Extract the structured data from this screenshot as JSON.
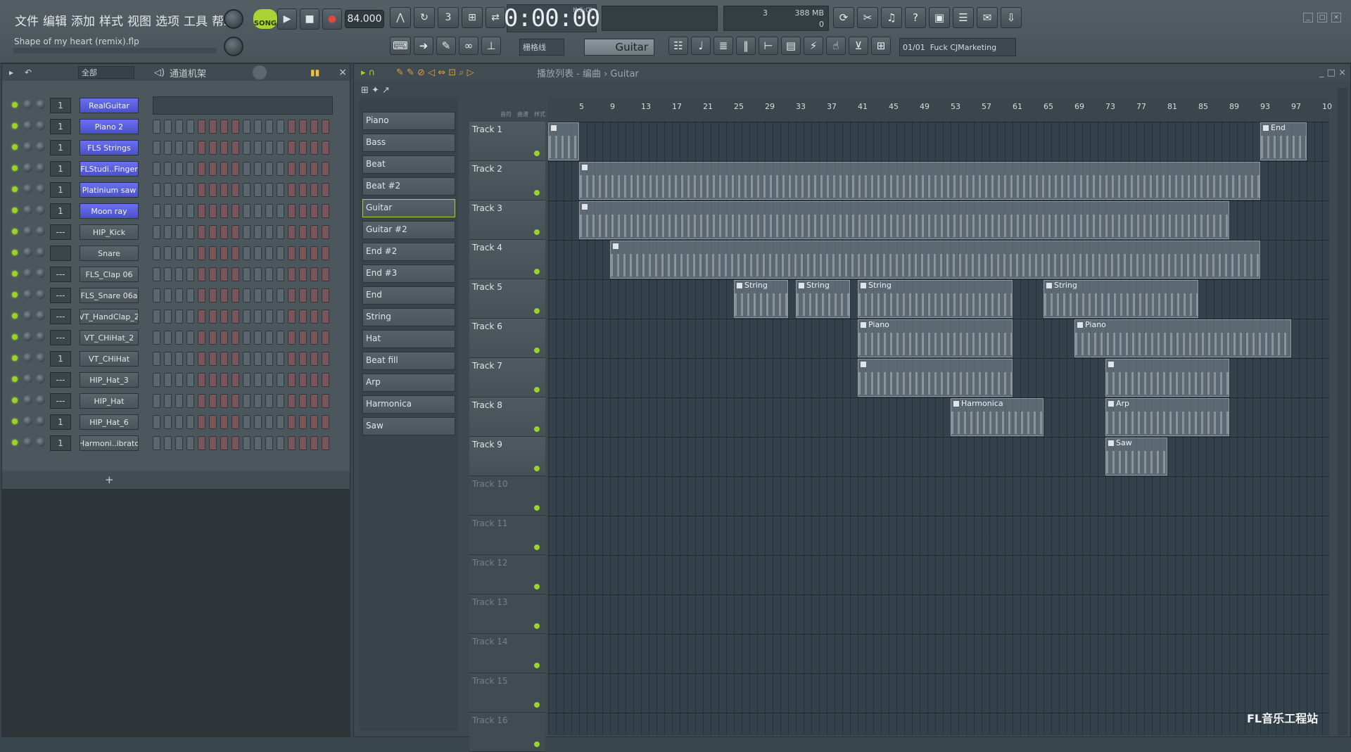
{
  "menu": [
    "文件",
    "编辑",
    "添加",
    "样式",
    "视图",
    "选项",
    "工具",
    "帮助"
  ],
  "project_file": "Shape of my heart (remix).flp",
  "transport": {
    "mode": "SONG",
    "tempo": "84.000",
    "time": "0:00:00",
    "time_unit": "M:S:CS"
  },
  "cpu": {
    "voices": "3",
    "memory": "388 MB",
    "zero": "0"
  },
  "snap": "栅格线",
  "selected_pattern": "Guitar",
  "hint": {
    "counter": "01/01",
    "text": "Fuck CJMarketing"
  },
  "rack": {
    "filter": "全部",
    "title": "通道机架",
    "add": "+",
    "channels": [
      {
        "name": "RealGuitar",
        "num": "1",
        "style": "blue"
      },
      {
        "name": "Piano 2",
        "num": "1",
        "style": "blue"
      },
      {
        "name": "FLS Strings",
        "num": "1",
        "style": "blue"
      },
      {
        "name": "FLStudi..Finger",
        "num": "1",
        "style": "blue"
      },
      {
        "name": "Platinium saw",
        "num": "1",
        "style": "blue"
      },
      {
        "name": "Moon ray",
        "num": "1",
        "style": "blue"
      },
      {
        "name": "HIP_Kick",
        "num": "---",
        "style": "gray"
      },
      {
        "name": "Snare",
        "num": "",
        "style": "gray"
      },
      {
        "name": "FLS_Clap 06",
        "num": "---",
        "style": "gray"
      },
      {
        "name": "FLS_Snare 06a",
        "num": "---",
        "style": "gray"
      },
      {
        "name": "VT_HandClap_2",
        "num": "---",
        "style": "gray"
      },
      {
        "name": "VT_CHiHat_2",
        "num": "---",
        "style": "gray"
      },
      {
        "name": "VT_CHiHat",
        "num": "1",
        "style": "gray"
      },
      {
        "name": "HIP_Hat_3",
        "num": "---",
        "style": "gray"
      },
      {
        "name": "HIP_Hat",
        "num": "---",
        "style": "gray"
      },
      {
        "name": "HIP_Hat_6",
        "num": "1",
        "style": "gray"
      },
      {
        "name": "Harmoni..ibrato",
        "num": "1",
        "style": "gray"
      }
    ]
  },
  "playlist": {
    "breadcrumb": "播放列表 - 编曲 › Guitar",
    "picker_tabs": [
      "音符",
      "曲谱",
      "样式"
    ],
    "patterns": [
      "Piano",
      "Bass",
      "Beat",
      "Beat #2",
      "Guitar",
      "Guitar #2",
      "End #2",
      "End #3",
      "End",
      "String",
      "Hat",
      "Beat fill",
      "Arp",
      "Harmonica",
      "Saw"
    ],
    "ruler": [
      "5",
      "9",
      "13",
      "17",
      "21",
      "25",
      "29",
      "33",
      "37",
      "41",
      "45",
      "49",
      "53",
      "57",
      "61",
      "65",
      "69",
      "73",
      "77",
      "81",
      "85",
      "89",
      "93",
      "97",
      "10"
    ],
    "tracks": [
      "Track 1",
      "Track 2",
      "Track 3",
      "Track 4",
      "Track 5",
      "Track 6",
      "Track 7",
      "Track 8",
      "Track 9",
      "Track 10",
      "Track 11",
      "Track 12",
      "Track 13",
      "Track 14",
      "Track 15",
      "Track 16"
    ],
    "clips": [
      {
        "label": "",
        "track": 0,
        "start": 1,
        "bars": 4
      },
      {
        "label": "End",
        "track": 0,
        "start": 93,
        "bars": 6
      },
      {
        "label": "",
        "track": 1,
        "start": 5,
        "bars": 88
      },
      {
        "label": "",
        "track": 2,
        "start": 5,
        "bars": 84
      },
      {
        "label": "",
        "track": 3,
        "start": 9,
        "bars": 84
      },
      {
        "label": "String",
        "track": 4,
        "start": 25,
        "bars": 7
      },
      {
        "label": "String",
        "track": 4,
        "start": 33,
        "bars": 7
      },
      {
        "label": "String",
        "track": 4,
        "start": 41,
        "bars": 20
      },
      {
        "label": "String",
        "track": 4,
        "start": 65,
        "bars": 20
      },
      {
        "label": "Piano",
        "track": 5,
        "start": 41,
        "bars": 20
      },
      {
        "label": "Piano",
        "track": 5,
        "start": 69,
        "bars": 28
      },
      {
        "label": "",
        "track": 6,
        "start": 41,
        "bars": 20
      },
      {
        "label": "",
        "track": 6,
        "start": 73,
        "bars": 16
      },
      {
        "label": "Harmonica",
        "track": 7,
        "start": 53,
        "bars": 12
      },
      {
        "label": "Arp",
        "track": 7,
        "start": 73,
        "bars": 16
      },
      {
        "label": "Saw",
        "track": 8,
        "start": 73,
        "bars": 8
      }
    ]
  },
  "watermark": "FL音乐工程站"
}
